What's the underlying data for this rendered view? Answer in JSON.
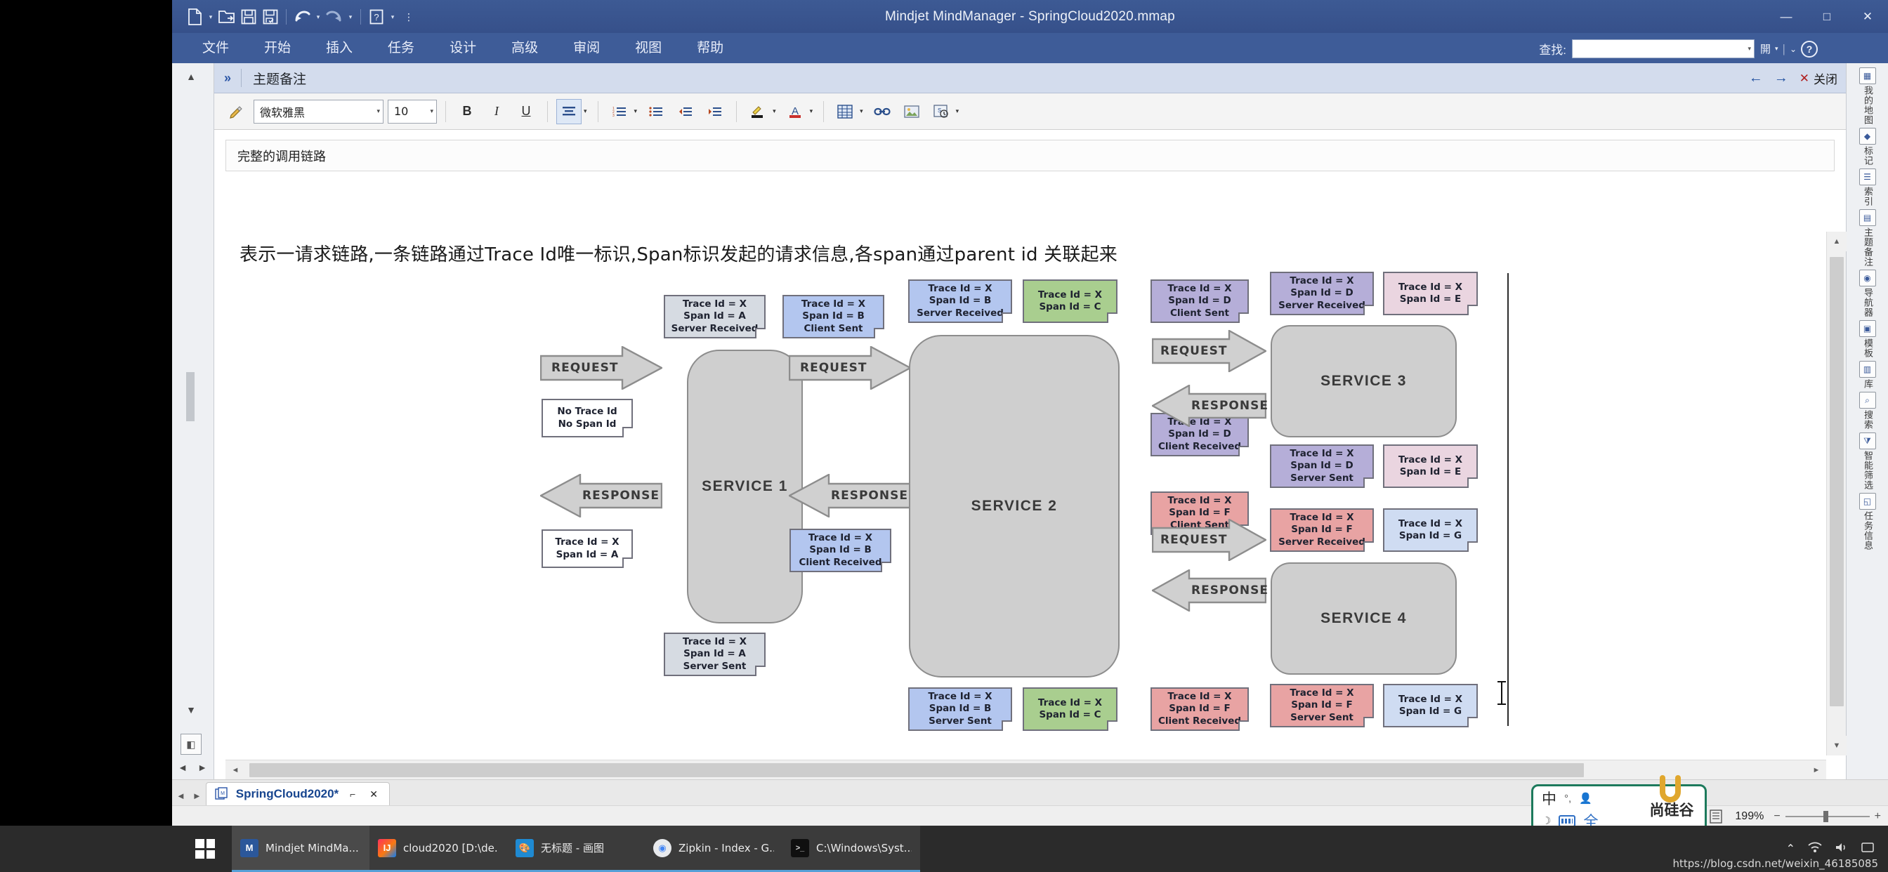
{
  "window": {
    "title": "Mindjet MindManager - SpringCloud2020.mmap",
    "minimize": "—",
    "maximize": "□",
    "close": "✕"
  },
  "quick_access": {
    "new": "new-document",
    "open": "open-folder",
    "save": "save-disk",
    "save_as": "save-as",
    "undo": "undo-arrow",
    "redo": "redo-arrow",
    "help": "help-question",
    "more": "more-options"
  },
  "menu": {
    "items": [
      {
        "label": "文件"
      },
      {
        "label": "开始"
      },
      {
        "label": "插入"
      },
      {
        "label": "任务"
      },
      {
        "label": "设计"
      },
      {
        "label": "高级"
      },
      {
        "label": "审阅"
      },
      {
        "label": "视图"
      },
      {
        "label": "帮助"
      }
    ]
  },
  "find": {
    "label": "查找:",
    "value": "",
    "placeholder": ""
  },
  "left_strip": {
    "top_arrow": "▲",
    "bottom_arrow": "▼",
    "expand": "◧",
    "nav_left": "◄",
    "nav_right": "►"
  },
  "right_strip": {
    "items": [
      {
        "label": "我的地图",
        "icon": "map-icon"
      },
      {
        "label": "标记",
        "icon": "tag-icon"
      },
      {
        "label": "索引",
        "icon": "index-icon"
      },
      {
        "label": "主题备注",
        "icon": "note-icon"
      },
      {
        "label": "导航器",
        "icon": "compass-icon"
      },
      {
        "label": "模板",
        "icon": "template-icon"
      },
      {
        "label": "库",
        "icon": "library-icon"
      },
      {
        "label": "搜索",
        "icon": "search-icon"
      },
      {
        "label": "智能筛选",
        "icon": "filter-icon"
      },
      {
        "label": "任务信息",
        "icon": "task-icon"
      }
    ]
  },
  "notes_panel": {
    "chevron": "»",
    "title": "主题备注",
    "prev": "←",
    "next": "→",
    "close_x": "✕",
    "close_label": "关闭"
  },
  "format_toolbar": {
    "format_painter": "format-painter",
    "font_name": "微软雅黑",
    "font_size": "10",
    "bold": "B",
    "italic": "I",
    "underline": "U",
    "align": "align-center",
    "numbered_list": "numbered-list",
    "bulleted_list": "bulleted-list",
    "decrease_indent": "decrease-indent",
    "increase_indent": "increase-indent",
    "highlight": "highlight-color",
    "font_color": "font-color",
    "insert_table": "insert-table",
    "hyperlink": "hyperlink",
    "insert_image": "insert-image",
    "insert_object": "insert-object"
  },
  "note": {
    "heading": "完整的调用链路",
    "paragraph": "表示一请求链路,一条链路通过Trace Id唯一标识,Span标识发起的请求信息,各span通过parent id 关联起来"
  },
  "diagram": {
    "services": [
      {
        "name": "SERVICE 1"
      },
      {
        "name": "SERVICE 2"
      },
      {
        "name": "SERVICE 3"
      },
      {
        "name": "SERVICE 4"
      }
    ],
    "arrows": [
      {
        "label": "REQUEST",
        "dir": "right"
      },
      {
        "label": "REQUEST",
        "dir": "right"
      },
      {
        "label": "RESPONSE",
        "dir": "left"
      },
      {
        "label": "RESPONSE",
        "dir": "left"
      },
      {
        "label": "REQUEST",
        "dir": "right"
      },
      {
        "label": "RESPONSE",
        "dir": "left"
      },
      {
        "label": "REQUEST",
        "dir": "right"
      },
      {
        "label": "RESPONSE",
        "dir": "left"
      }
    ],
    "spans": [
      {
        "id": "s1-in",
        "lines": [
          "No Trace Id",
          "No Span Id"
        ],
        "color": "#ffffff"
      },
      {
        "id": "s1-sr",
        "lines": [
          "Trace Id = X",
          "Span Id = A",
          "Server Received"
        ],
        "color": "#d6dbe2"
      },
      {
        "id": "s1-ss",
        "lines": [
          "Trace Id = X",
          "Span Id = A",
          "Server Sent"
        ],
        "color": "#d6dbe2"
      },
      {
        "id": "s1-out",
        "lines": [
          "Trace Id = X",
          "Span Id = A"
        ],
        "color": "#ffffff"
      },
      {
        "id": "s1-cs",
        "lines": [
          "Trace Id = X",
          "Span Id = B",
          "Client Sent"
        ],
        "color": "#b3c6ef"
      },
      {
        "id": "s1-cr",
        "lines": [
          "Trace Id = X",
          "Span Id = B",
          "Client Received"
        ],
        "color": "#b3c6ef"
      },
      {
        "id": "s2-sr",
        "lines": [
          "Trace Id = X",
          "Span Id = B",
          "Server Received"
        ],
        "color": "#b3c6ef"
      },
      {
        "id": "s2-c-top",
        "lines": [
          "Trace Id = X",
          "Span Id = C"
        ],
        "color": "#a9ce8f"
      },
      {
        "id": "s2-ss",
        "lines": [
          "Trace Id = X",
          "Span Id = B",
          "Server Sent"
        ],
        "color": "#b3c6ef"
      },
      {
        "id": "s2-c-bot",
        "lines": [
          "Trace Id = X",
          "Span Id = C"
        ],
        "color": "#a9ce8f"
      },
      {
        "id": "s2-d-cs",
        "lines": [
          "Trace Id = X",
          "Span Id = D",
          "Client Sent"
        ],
        "color": "#b5aed8"
      },
      {
        "id": "s2-d-cr",
        "lines": [
          "Trace Id = X",
          "Span Id = D",
          "Client Received"
        ],
        "color": "#b5aed8"
      },
      {
        "id": "s2-f-cs",
        "lines": [
          "Trace Id = X",
          "Span Id = F",
          "Client Sent"
        ],
        "color": "#e8a3a3"
      },
      {
        "id": "s2-f-cr",
        "lines": [
          "Trace Id = X",
          "Span Id = F",
          "Client Received"
        ],
        "color": "#e8a3a3"
      },
      {
        "id": "s3-sr",
        "lines": [
          "Trace Id = X",
          "Span Id = D",
          "Server Received"
        ],
        "color": "#b5aed8"
      },
      {
        "id": "s3-e-top",
        "lines": [
          "Trace Id = X",
          "Span Id = E"
        ],
        "color": "#ead5e0"
      },
      {
        "id": "s3-ss",
        "lines": [
          "Trace Id = X",
          "Span Id = D",
          "Server Sent"
        ],
        "color": "#b5aed8"
      },
      {
        "id": "s3-e-bot",
        "lines": [
          "Trace Id = X",
          "Span Id = E"
        ],
        "color": "#ead5e0"
      },
      {
        "id": "s4-sr",
        "lines": [
          "Trace Id = X",
          "Span Id = F",
          "Server Received"
        ],
        "color": "#e8a3a3"
      },
      {
        "id": "s4-g-top",
        "lines": [
          "Trace Id = X",
          "Span Id = G"
        ],
        "color": "#cfdcf2"
      },
      {
        "id": "s4-ss",
        "lines": [
          "Trace Id = X",
          "Span Id = F",
          "Server Sent"
        ],
        "color": "#e8a3a3"
      },
      {
        "id": "s4-g-bot",
        "lines": [
          "Trace Id = X",
          "Span Id = G"
        ],
        "color": "#cfdcf2"
      }
    ]
  },
  "doc_tab": {
    "name": "SpringCloud2020*",
    "restore": "⌐",
    "close": "✕"
  },
  "status": {
    "outline_view": "outline-view",
    "filter": "filter-icon",
    "zoom_fit": "zoom-fit",
    "fit_map": "fit-map",
    "detail": "detail-view",
    "zoom_level": "199%",
    "zoom_out": "−",
    "zoom_in": "+"
  },
  "ime": {
    "mode": "中",
    "punct": "°,",
    "user": "user-icon",
    "moon": "☽",
    "keyboard": "keyboard-icon",
    "width": "全",
    "brand": "尚硅谷"
  },
  "taskbar": {
    "start": "windows-start",
    "items": [
      {
        "label": "Mindjet MindMa...",
        "icon": "MM",
        "color": "#2b579a",
        "active": true
      },
      {
        "label": "cloud2020 [D:\\de...",
        "icon": "IJ",
        "color": "#c2185b",
        "active": false
      },
      {
        "label": "无标题 - 画图",
        "icon": "🎨",
        "color": "#1f8ad2",
        "active": false
      },
      {
        "label": "Zipkin - Index - G...",
        "icon": "C",
        "color": "#e8eaed",
        "active": false
      },
      {
        "label": "C:\\Windows\\Syst...",
        "icon": "▮",
        "color": "#1a1a1a",
        "active": false
      }
    ],
    "tray": {
      "show_hidden": "⌃",
      "network": "network-icon",
      "volume": "volume-icon",
      "notifications": "notification-icon"
    },
    "url": "https://blog.csdn.net/weixin_46185085"
  }
}
